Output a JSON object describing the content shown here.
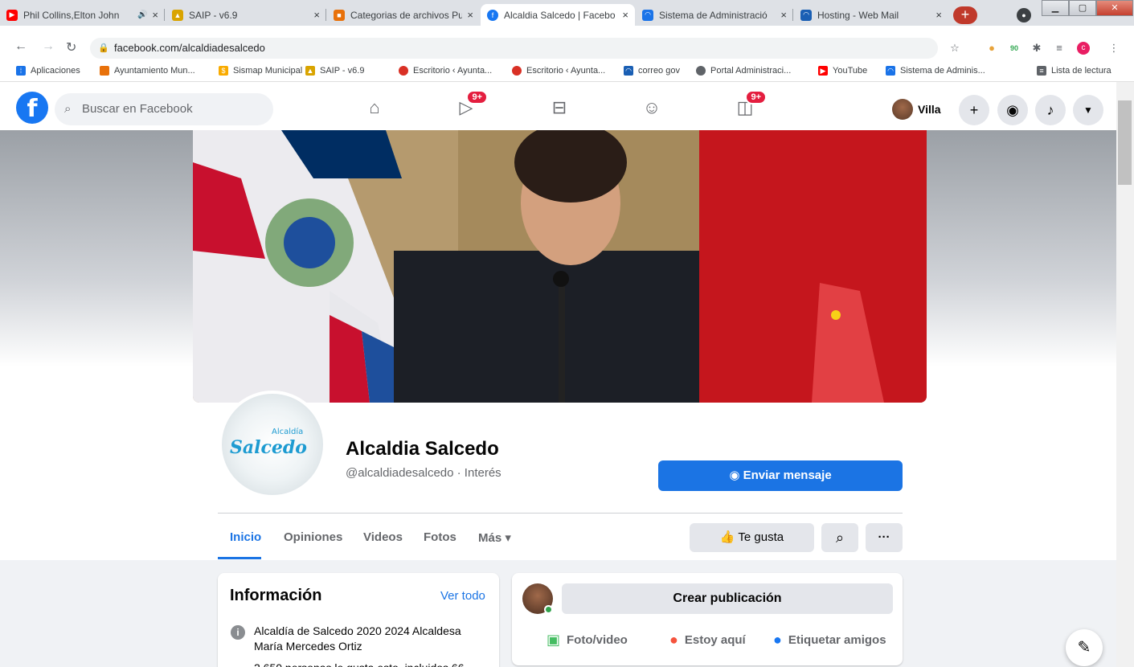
{
  "browser": {
    "tabs": [
      {
        "title": "Phil Collins,Elton John",
        "audio": "🔊",
        "close": "×",
        "fav": "youtube-icon",
        "color": "#ff0000"
      },
      {
        "title": "SAIP - v6.9",
        "close": "×",
        "fav": "saip-icon",
        "color": "#d9a400"
      },
      {
        "title": "Categorias de archivos Pu",
        "close": "×",
        "fav": "category-icon",
        "color": "#e8710a"
      },
      {
        "title": "Alcaldia Salcedo | Facebo",
        "close": "×",
        "fav": "facebook-icon",
        "color": "#1877f2"
      },
      {
        "title": "Sistema de Administració",
        "close": "×",
        "fav": "sistema-icon",
        "color": "#1a73e8"
      },
      {
        "title": "Hosting - Web Mail",
        "close": "×",
        "fav": "hosting-icon",
        "color": "#1a5fb4"
      }
    ],
    "new_tab": "+",
    "url": "facebook.com/alcaldiadesalcedo",
    "extension_badge": "90",
    "profile_letter": "c",
    "bookmarks": [
      {
        "label": "Aplicaciones",
        "color": "#1a73e8"
      },
      {
        "label": "Ayuntamiento Mun...",
        "color": "#e8710a"
      },
      {
        "label": "Sismap Municipal",
        "color": "#f9ab00"
      },
      {
        "label": "SAIP - v6.9",
        "color": "#d9a400"
      },
      {
        "label": "Escritorio ‹ Ayunta...",
        "color": "#d93025"
      },
      {
        "label": "Escritorio ‹ Ayunta...",
        "color": "#d93025"
      },
      {
        "label": "correo gov",
        "color": "#1a5fb4"
      },
      {
        "label": "Portal Administraci...",
        "color": "#5f6368"
      },
      {
        "label": "YouTube",
        "color": "#ff0000"
      },
      {
        "label": "Sistema de Adminis...",
        "color": "#1a73e8"
      },
      {
        "label": "Lista de lectura",
        "color": "#5f6368"
      }
    ]
  },
  "fb": {
    "search_placeholder": "Buscar en Facebook",
    "video_badge": "9+",
    "pages_badge": "9+",
    "user_name": "Villa",
    "page": {
      "name": "Alcaldia Salcedo",
      "handle": "@alcaldiadesalcedo · Interés",
      "logo_text": "Salcedo",
      "logo_small": "Alcaldía",
      "message_button": "Enviar mensaje",
      "tabs": [
        "Inicio",
        "Opiniones",
        "Videos",
        "Fotos",
        "Más ▾"
      ],
      "like_button": "Te gusta",
      "more_button": "···"
    },
    "info": {
      "title": "Información",
      "see_all": "Ver todo",
      "description": "Alcaldía de Salcedo 2020 2024 Alcaldesa María Mercedes Ortiz",
      "next_line": "2.650 personas le gusta esto, incluidos 66"
    },
    "composer": {
      "prompt": "Crear publicación",
      "actions": [
        "Foto/video",
        "Estoy aquí",
        "Etiquetar amigos"
      ]
    }
  }
}
